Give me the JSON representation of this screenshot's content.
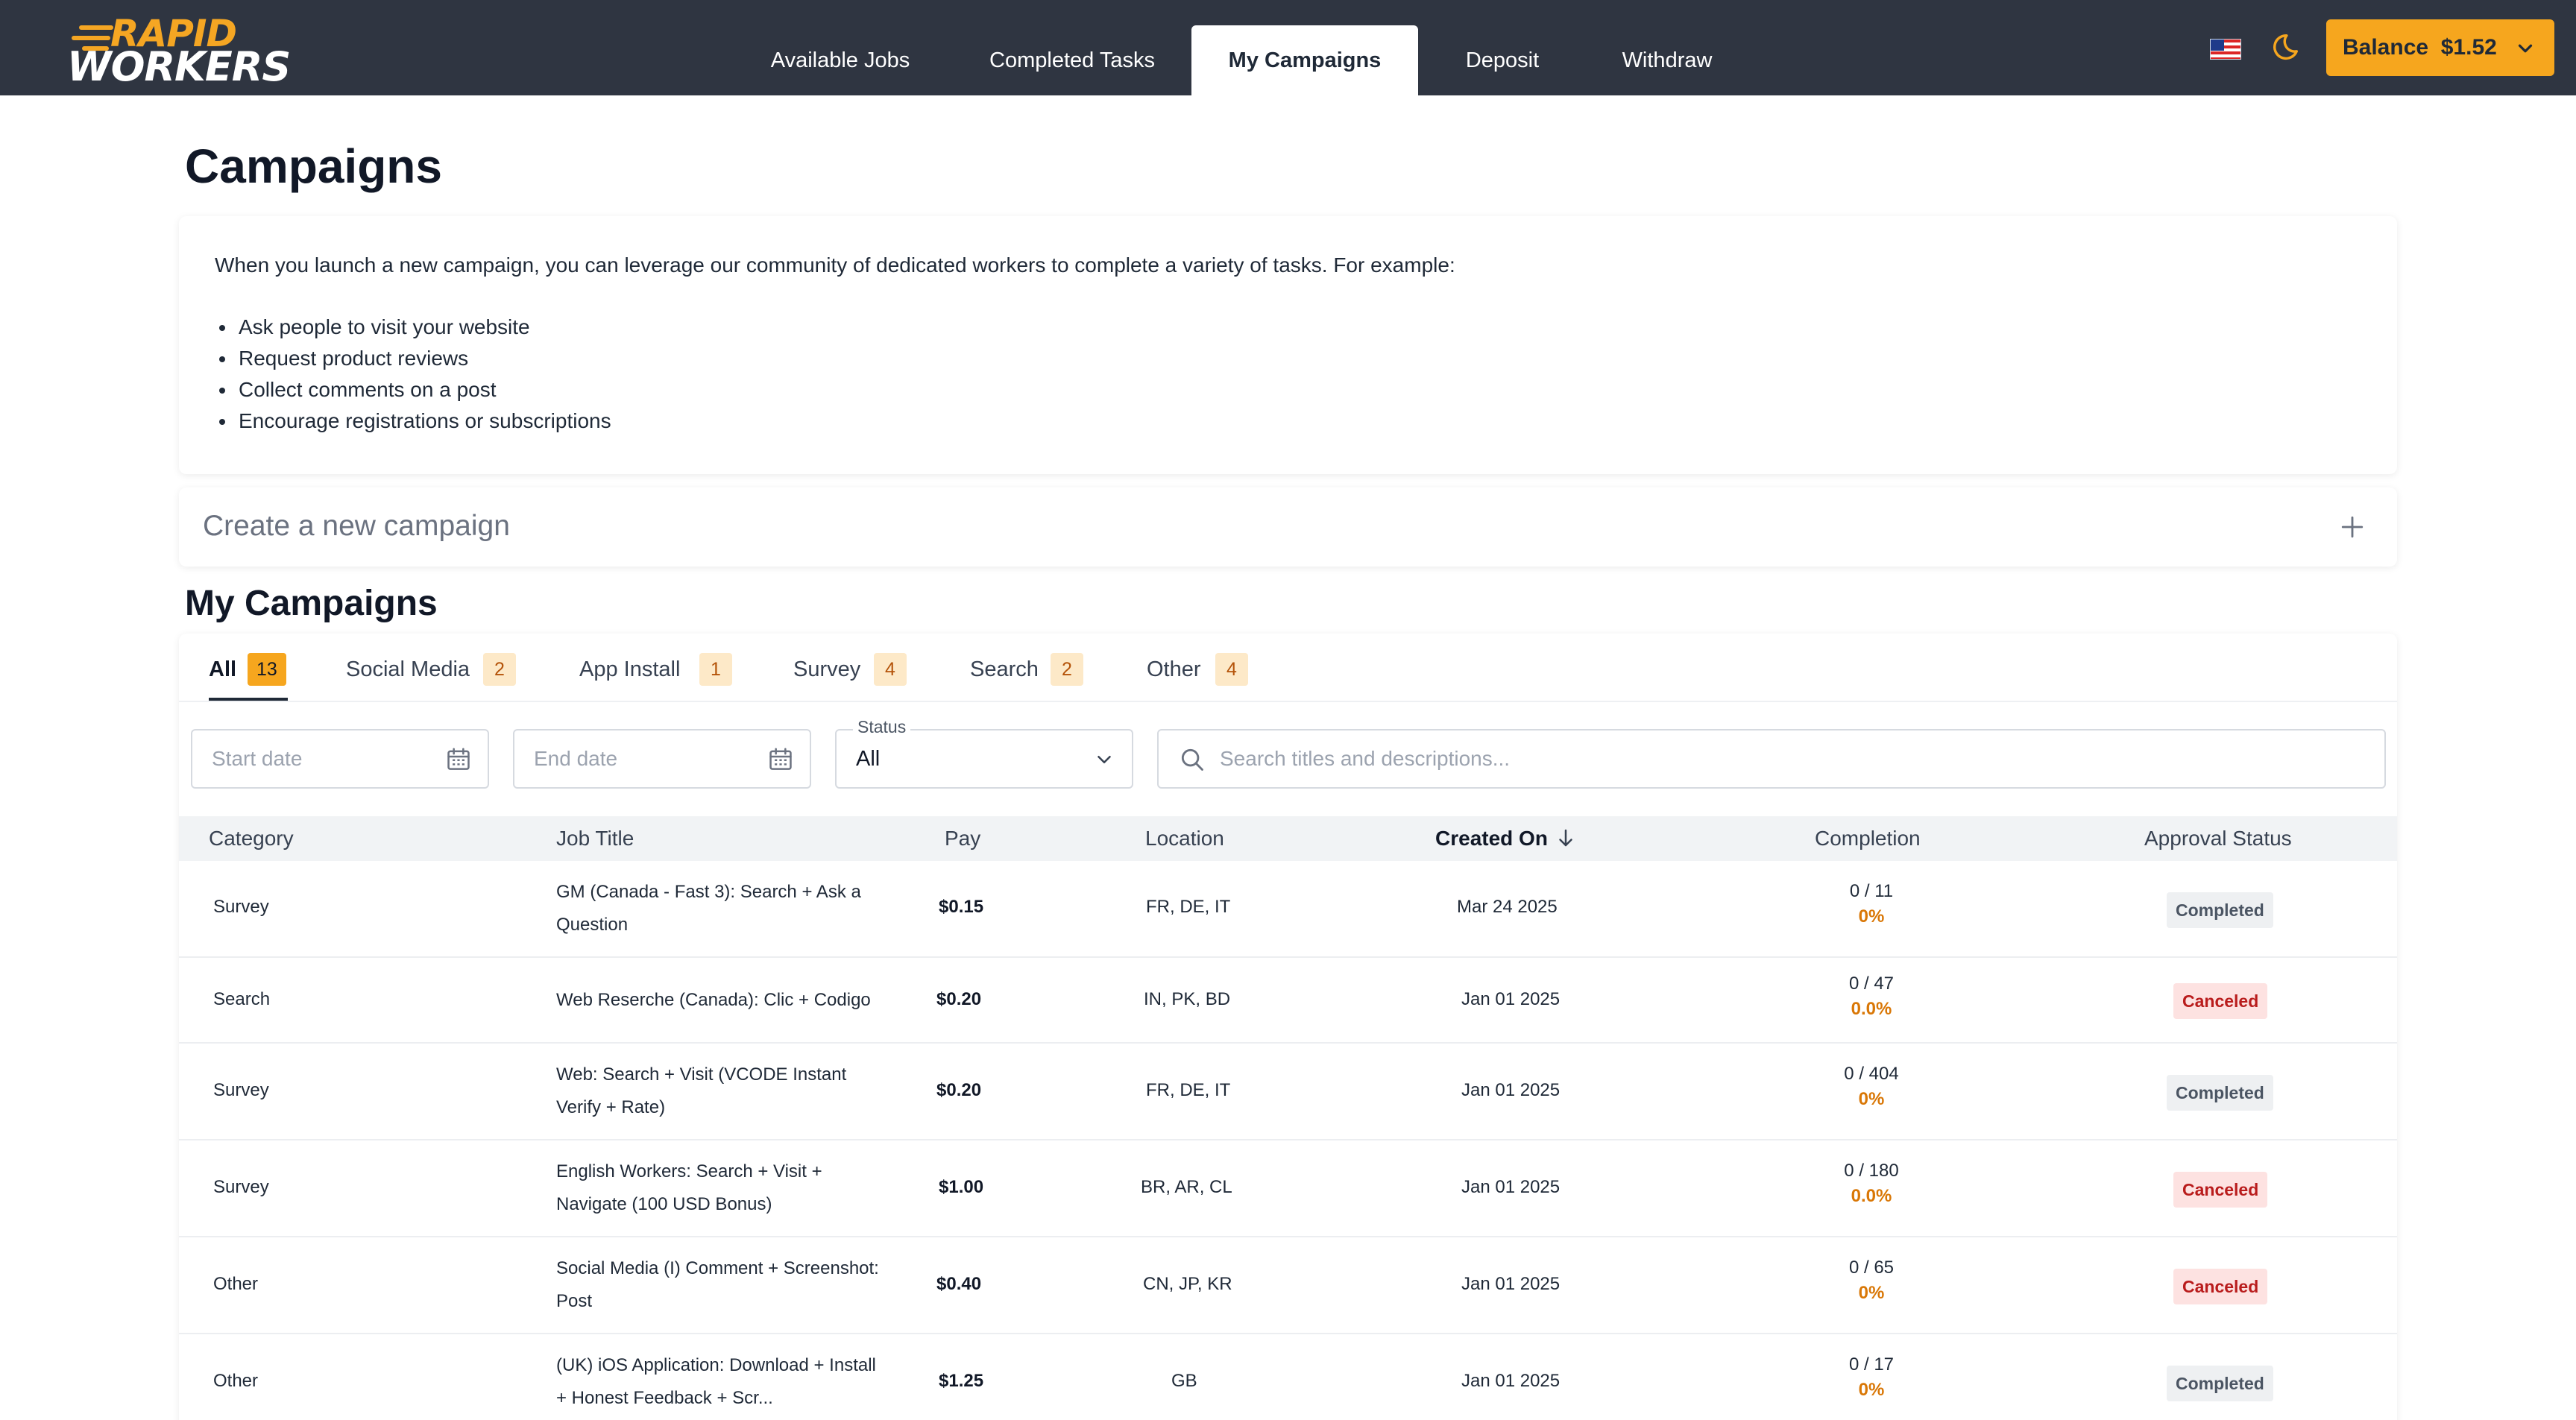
{
  "header": {
    "logo_top": "RAPID",
    "logo_bottom": "WORKERS",
    "nav": [
      {
        "label": "Available Jobs"
      },
      {
        "label": "Completed Tasks"
      },
      {
        "label": "My Campaigns",
        "active": true
      },
      {
        "label": "Deposit"
      },
      {
        "label": "Withdraw"
      }
    ],
    "flag_icon": "us-flag-icon",
    "theme_icon": "moon-icon",
    "balance_label": "Balance",
    "balance_value": "$1.52",
    "accent_color": "#f6a61e",
    "topbar_color": "#2f3541"
  },
  "page": {
    "title": "Campaigns",
    "intro": {
      "text": "When you launch a new campaign, you can leverage our community of dedicated workers to complete a variety of tasks. For example:",
      "bullets": [
        "Ask people to visit your website",
        "Request product reviews",
        "Collect comments on a post",
        "Encourage registrations or subscriptions"
      ]
    },
    "create_campaign": "Create a new campaign"
  },
  "campaigns": {
    "section_title": "My Campaigns",
    "tabs": [
      {
        "label": "All",
        "count": "13",
        "active": true
      },
      {
        "label": "Social Media",
        "count": "2"
      },
      {
        "label": "App Install",
        "count": "1"
      },
      {
        "label": "Survey",
        "count": "4"
      },
      {
        "label": "Search",
        "count": "2"
      },
      {
        "label": "Other",
        "count": "4"
      }
    ],
    "filters": {
      "start_placeholder": "Start date",
      "end_placeholder": "End date",
      "status_label": "Status",
      "status_value": "All",
      "search_placeholder": "Search titles and descriptions..."
    },
    "columns": [
      "Category",
      "Job Title",
      "Pay",
      "Location",
      "Created On",
      "Completion",
      "Approval Status"
    ],
    "rows": [
      {
        "category": "Survey",
        "title": "GM (Canada - Fast 3): Search + Ask a Question",
        "pay": "$0.15",
        "location": "FR, DE, IT",
        "created": "Mar 24 2025",
        "completion": "0 / 11",
        "percent": "0%",
        "status": "Completed"
      },
      {
        "category": "Search",
        "title": "Web Reserche (Canada): Clic + Codigo",
        "pay": "$0.20",
        "location": "IN, PK, BD",
        "created": "Jan 01 2025",
        "completion": "0 / 47",
        "percent": "0.0%",
        "status": "Canceled"
      },
      {
        "category": "Survey",
        "title": "Web: Search + Visit (VCODE Instant Verify + Rate)",
        "pay": "$0.20",
        "location": "FR, DE, IT",
        "created": "Jan 01 2025",
        "completion": "0 / 404",
        "percent": "0%",
        "status": "Completed"
      },
      {
        "category": "Survey",
        "title": "English Workers: Search + Visit + Navigate (100 USD Bonus)",
        "pay": "$1.00",
        "location": "BR, AR, CL",
        "created": "Jan 01 2025",
        "completion": "0 / 180",
        "percent": "0.0%",
        "status": "Canceled"
      },
      {
        "category": "Other",
        "title": "Social Media (I) Comment + Screenshot: Post",
        "pay": "$0.40",
        "location": "CN, JP, KR",
        "created": "Jan 01 2025",
        "completion": "0 / 65",
        "percent": "0%",
        "status": "Canceled"
      },
      {
        "category": "Other",
        "title": "(UK) iOS Application: Download + Install + Honest Feedback + Scr...",
        "pay": "$1.25",
        "location": "GB",
        "created": "Jan 01 2025",
        "completion": "0 / 17",
        "percent": "0%",
        "status": "Completed"
      }
    ]
  }
}
